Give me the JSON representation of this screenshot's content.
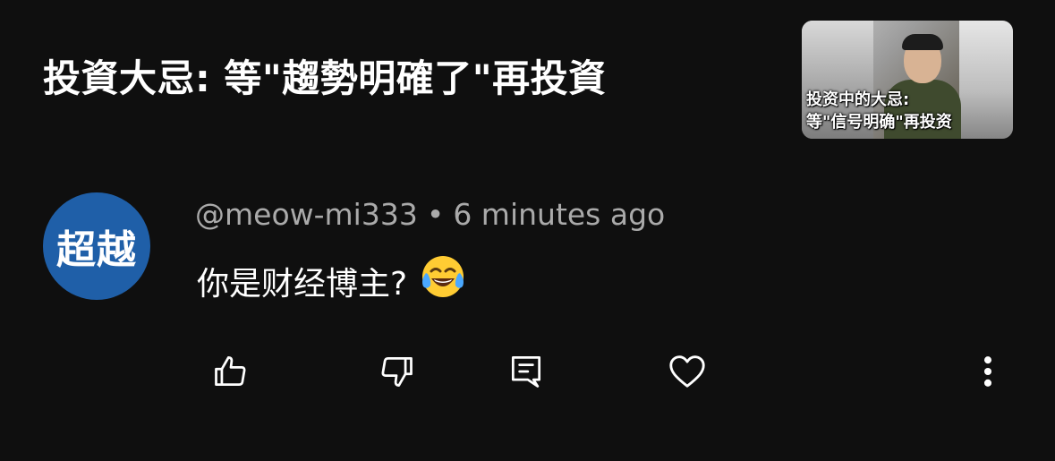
{
  "video": {
    "title": "投資大忌: 等\"趨勢明確了\"再投資",
    "thumbnail_caption_line1": "投资中的大忌:",
    "thumbnail_caption_line2": "等\"信号明确\"再投资"
  },
  "comment": {
    "avatar_text": "超越",
    "avatar_color": "#1f5fa8",
    "author": "@meow-mi333",
    "separator": "•",
    "time": "6 minutes ago",
    "text": "你是财经博主?",
    "emoji": "face-with-tears-of-joy"
  },
  "actions": {
    "like": "thumb-up-icon",
    "dislike": "thumb-down-icon",
    "reply": "reply-comment-icon",
    "heart": "heart-icon",
    "more": "more-vertical-icon"
  },
  "colors": {
    "background": "#0f0f0f",
    "primary_text": "#ffffff",
    "secondary_text": "#aaaaaa"
  }
}
